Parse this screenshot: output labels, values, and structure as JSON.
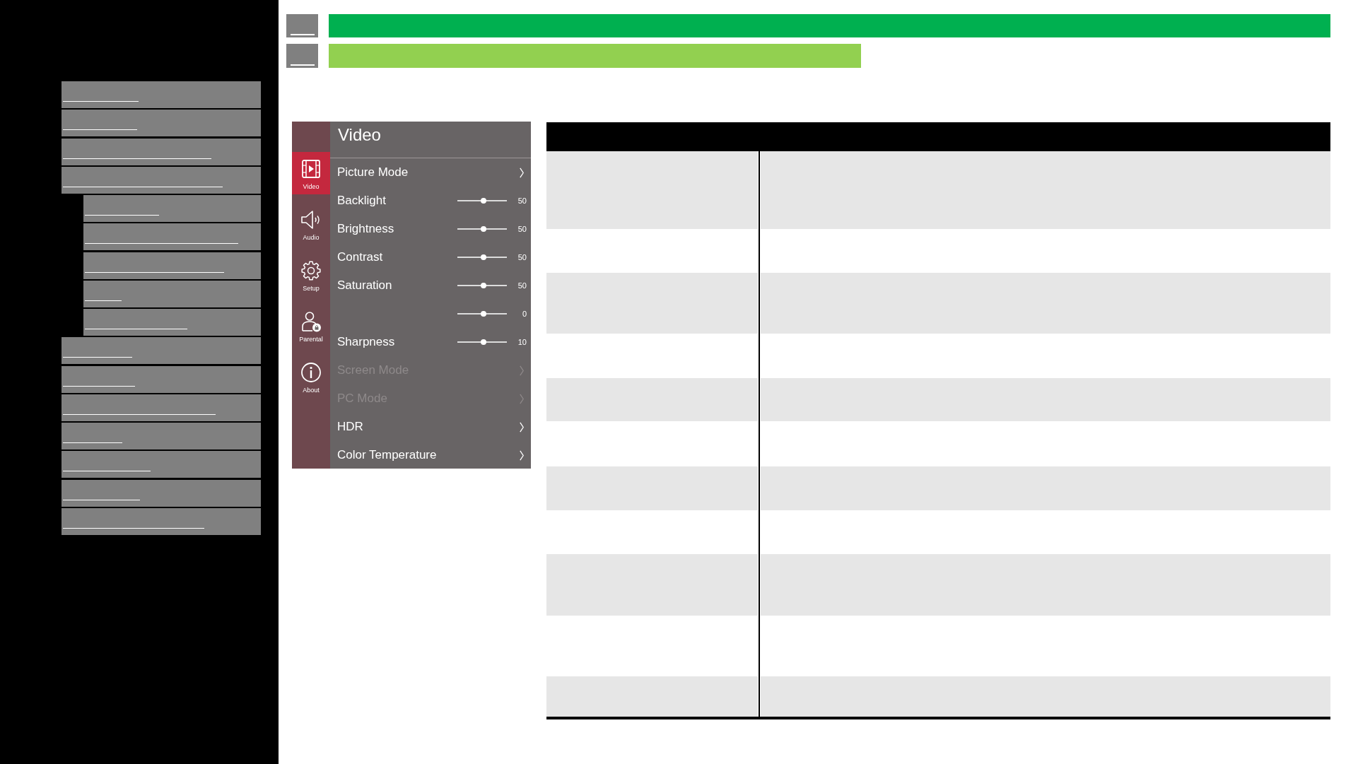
{
  "sidebar": {
    "items": [
      {
        "kind": "link"
      },
      {
        "kind": "link"
      },
      {
        "kind": "link"
      },
      {
        "kind": "link",
        "children": [
          {
            "kind": "link"
          },
          {
            "kind": "link"
          },
          {
            "kind": "link"
          },
          {
            "kind": "link"
          },
          {
            "kind": "link"
          }
        ]
      },
      {
        "kind": "link"
      },
      {
        "kind": "link"
      },
      {
        "kind": "link"
      },
      {
        "kind": "link"
      },
      {
        "kind": "link"
      },
      {
        "kind": "link"
      },
      {
        "kind": "link"
      }
    ]
  },
  "header": {
    "rows": [
      {
        "kind": "section"
      },
      {
        "kind": "subsection"
      }
    ]
  },
  "tv_menu": {
    "title": "Video",
    "tabs": [
      {
        "kind": "video",
        "label": "Video",
        "selected": true
      },
      {
        "kind": "audio",
        "label": "Audio",
        "selected": false
      },
      {
        "kind": "setup",
        "label": "Setup",
        "selected": false
      },
      {
        "kind": "parental",
        "label": "Parental",
        "selected": false
      },
      {
        "kind": "about",
        "label": "About",
        "selected": false
      }
    ],
    "items": [
      {
        "kind": "submenu",
        "label": "Picture Mode",
        "disabled": false
      },
      {
        "kind": "slider",
        "label": "Backlight",
        "level": 0.53,
        "reading": "50",
        "disabled": false
      },
      {
        "kind": "slider",
        "label": "Brightness",
        "level": 0.53,
        "reading": "50",
        "disabled": false
      },
      {
        "kind": "slider",
        "label": "Contrast",
        "level": 0.53,
        "reading": "50",
        "disabled": false
      },
      {
        "kind": "slider",
        "label": "Saturation",
        "level": 0.53,
        "reading": "50",
        "disabled": false
      },
      {
        "kind": "slider",
        "level": 0.53,
        "reading": "0",
        "disabled": false
      },
      {
        "kind": "slider",
        "label": "Sharpness",
        "level": 0.53,
        "reading": "10",
        "disabled": false
      },
      {
        "kind": "submenu",
        "label": "Screen Mode",
        "disabled": true
      },
      {
        "kind": "submenu",
        "label": "PC Mode",
        "disabled": true
      },
      {
        "kind": "submenu",
        "label": "HDR",
        "disabled": false
      },
      {
        "kind": "submenu",
        "label": "Color Temperature",
        "disabled": false
      }
    ]
  },
  "table": {
    "rows": [
      {
        "shaded": true
      },
      {
        "shaded": false
      },
      {
        "shaded": true
      },
      {
        "shaded": false
      },
      {
        "shaded": true
      },
      {
        "shaded": false
      },
      {
        "shaded": true
      },
      {
        "shaded": false
      },
      {
        "shaded": true
      },
      {
        "shaded": false
      },
      {
        "shaded": true
      }
    ]
  }
}
